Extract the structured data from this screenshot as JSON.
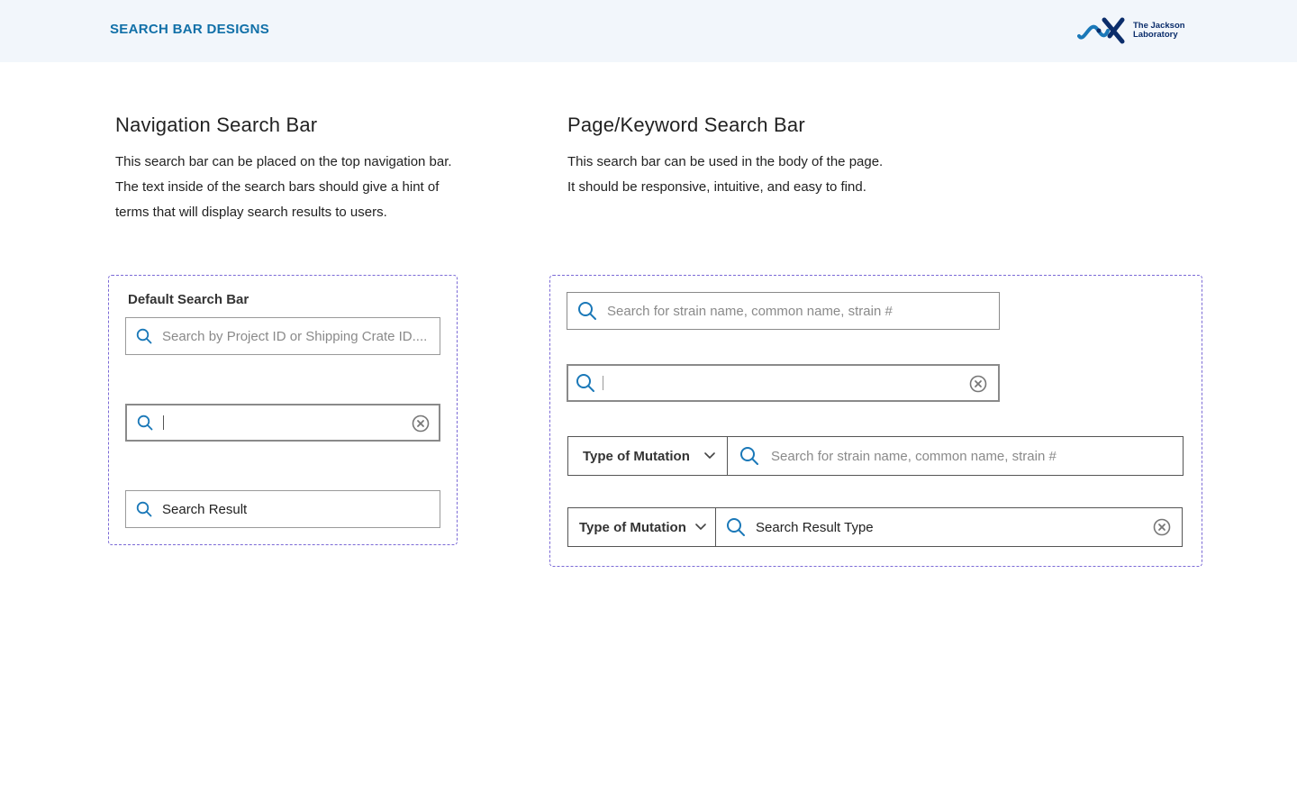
{
  "header": {
    "title": "SEARCH BAR DESIGNS",
    "logo": {
      "line1": "The Jackson",
      "line2": "Laboratory",
      "color": "#0b2d6b"
    }
  },
  "navigation": {
    "title": "Navigation Search Bar",
    "description": [
      "This search bar can be placed on the top navigation bar.",
      "The text inside of the search bars should give a hint of",
      "terms that will display search results to users."
    ],
    "panel": {
      "label": "Default Search Bar",
      "bars": [
        {
          "state": "default",
          "placeholder": "Search by Project ID or Shipping Crate ID....",
          "icon": "search-icon"
        },
        {
          "state": "active",
          "value": "",
          "icon": "search-icon",
          "clear_icon": "close-circle-icon"
        },
        {
          "state": "filled",
          "value": "Search Result",
          "icon": "search-icon"
        }
      ]
    }
  },
  "keyword": {
    "title": "Page/Keyword Search Bar",
    "description": [
      "This search bar can be used in the body of the page.",
      "It should be responsive, intuitive, and easy to find."
    ],
    "panel": {
      "bars": [
        {
          "state": "default",
          "placeholder": "Search for strain name, common name, strain #",
          "icon": "search-icon"
        },
        {
          "state": "active",
          "value": "",
          "icon": "search-icon",
          "clear_icon": "close-circle-icon"
        }
      ],
      "combos": [
        {
          "dropdown_label": "Type of Mutation",
          "placeholder": "Search for strain name, common name, strain #"
        },
        {
          "dropdown_label": "Type of Mutation",
          "value": "Search Result Type",
          "clear_icon": "close-circle-icon"
        }
      ]
    }
  },
  "colors": {
    "accent": "#1170a8",
    "header_bg": "#f2f6fb",
    "panel_border": "#7b6ad6",
    "icon_blue": "#1a78b8"
  }
}
